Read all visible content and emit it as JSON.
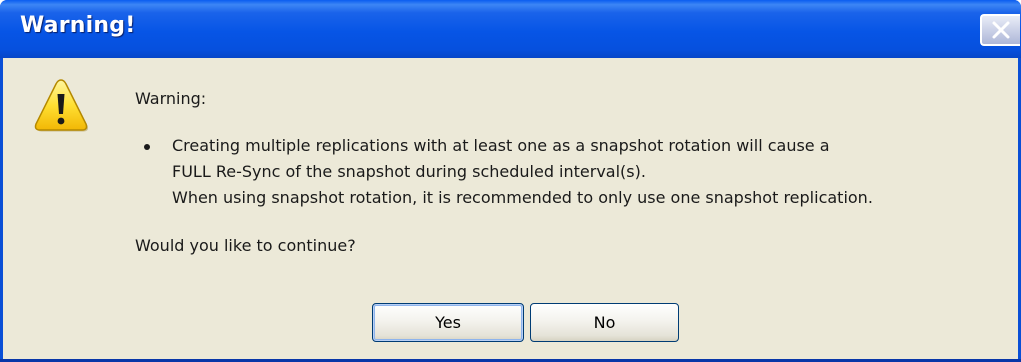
{
  "window": {
    "title": "Warning!",
    "close_icon": "close-icon"
  },
  "message": {
    "icon": "warning-icon",
    "heading": "Warning:",
    "bullet_lines": [
      "Creating multiple replications with at least one as a snapshot rotation will cause a",
      "FULL Re-Sync of the snapshot during scheduled interval(s).",
      "When using snapshot rotation, it is recommended to only use one snapshot replication."
    ],
    "question": "Would you like to continue?"
  },
  "buttons": {
    "yes_label": "Yes",
    "no_label": "No"
  },
  "colors": {
    "titlebar": "#0755e6",
    "client": "#ece9d8",
    "warning_yellow": "#ffe033"
  }
}
